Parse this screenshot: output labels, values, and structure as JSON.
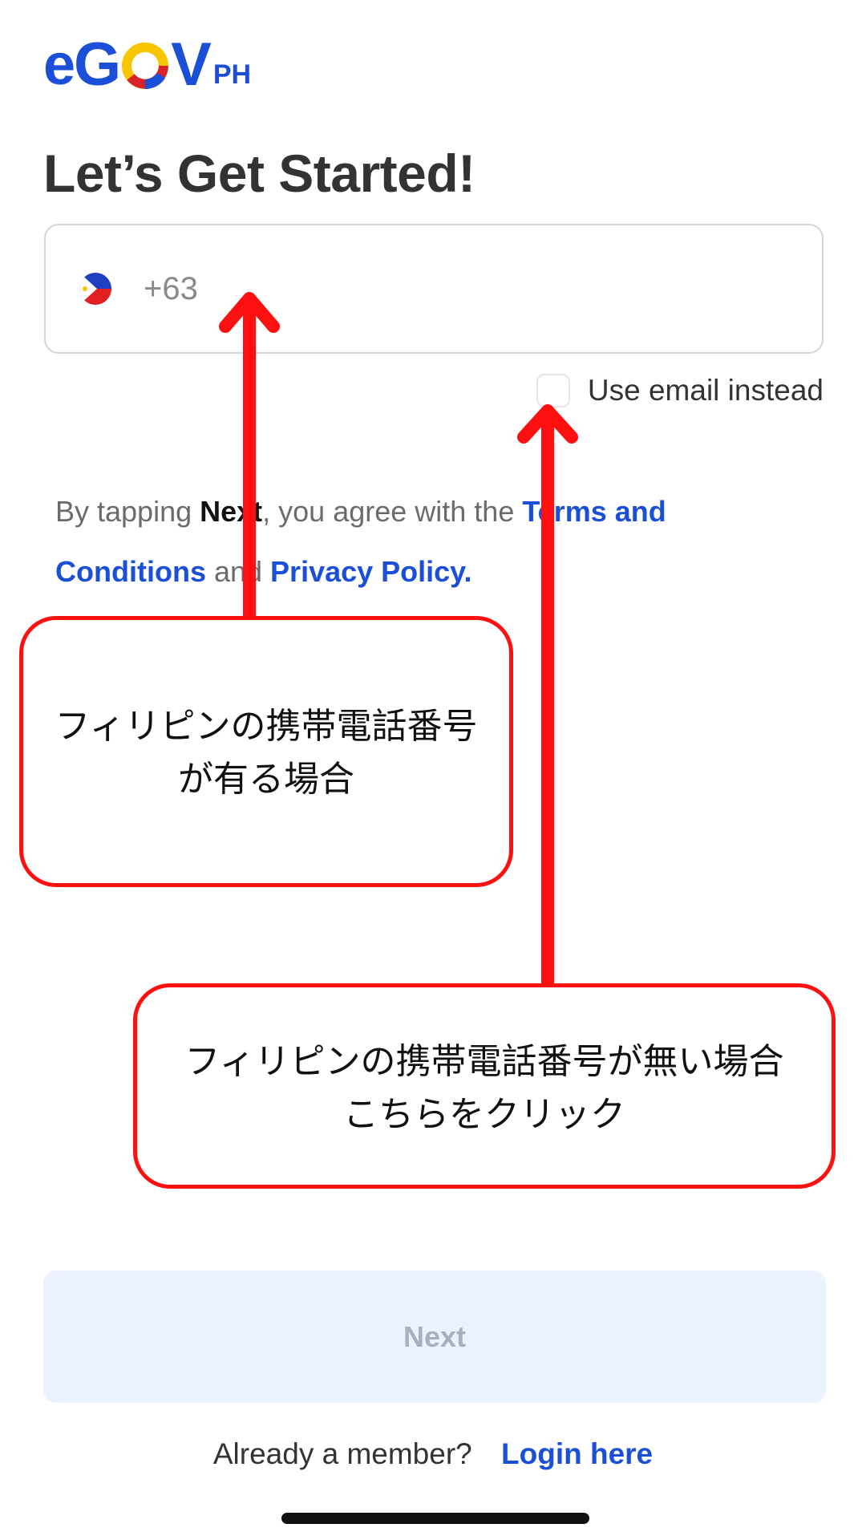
{
  "app": {
    "logo": {
      "e": "e",
      "g": "G",
      "v": "V",
      "ph": "PH",
      "o_colors": [
        "#f7c600",
        "#d9222a",
        "#1b4fd8"
      ]
    },
    "brand_color": "#1b4fd8"
  },
  "page": {
    "title": "Let’s Get Started!"
  },
  "phone": {
    "country_code_placeholder": "+63",
    "value": "",
    "flag_icon": "philippines-flag-icon"
  },
  "email_toggle": {
    "label": "Use email instead",
    "checked": false
  },
  "terms": {
    "prefix": "By tapping ",
    "next_word": "Next",
    "middle": ", you agree with the ",
    "terms_link": "Terms and Conditions",
    "and": " and ",
    "privacy_link": "Privacy Policy."
  },
  "annotations": {
    "callout_1": "フィリピンの携帯電話番号\nが有る場合",
    "callout_2": "フィリピンの携帯電話番号が無い場合\nこちらをクリック",
    "color": "#ff1010"
  },
  "actions": {
    "next_label": "Next"
  },
  "footer": {
    "member_text": "Already a member?",
    "login_link": "Login here"
  }
}
